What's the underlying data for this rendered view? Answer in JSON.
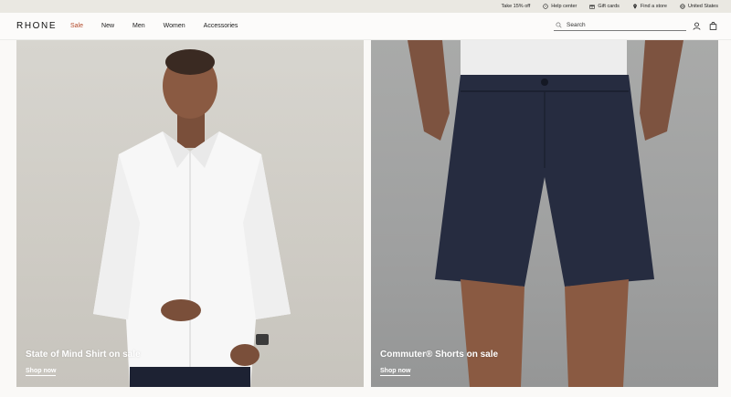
{
  "utility_bar": {
    "items": [
      {
        "label": "Take 15% off",
        "icon": "none"
      },
      {
        "label": "Help center",
        "icon": "help-circle-icon"
      },
      {
        "label": "Gift cards",
        "icon": "gift-icon"
      },
      {
        "label": "Find a store",
        "icon": "location-pin-icon"
      },
      {
        "label": "United States",
        "icon": "globe-icon"
      }
    ]
  },
  "header": {
    "logo": "RHONE",
    "nav": [
      {
        "label": "Sale"
      },
      {
        "label": "New"
      },
      {
        "label": "Men"
      },
      {
        "label": "Women"
      },
      {
        "label": "Accessories"
      }
    ],
    "search": {
      "placeholder": "Search",
      "value": ""
    },
    "icons": [
      "account-icon",
      "shopping-bag-icon"
    ]
  },
  "hero": {
    "cards": [
      {
        "title": "State of Mind Shirt on sale",
        "cta": "Shop now"
      },
      {
        "title": "Commuter® Shorts on sale",
        "cta": "Shop now"
      }
    ]
  },
  "colors": {
    "sale_accent": "#b34a2a",
    "utility_bg": "#eae8e2",
    "page_bg": "#faf9f7"
  }
}
